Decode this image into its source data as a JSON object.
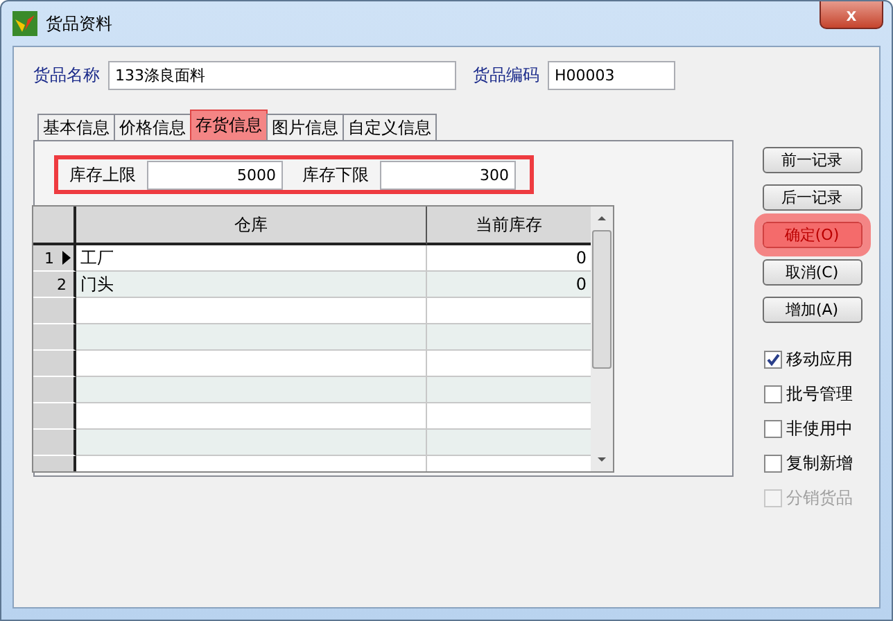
{
  "window": {
    "title": "货品资料",
    "close": "x"
  },
  "header_fields": [
    {
      "label": "货品名称",
      "value": "133涤良面料"
    },
    {
      "label": "货品编码",
      "value": "H00003"
    }
  ],
  "tabs": [
    {
      "label": "基本信息",
      "selected": false,
      "highlighted": false
    },
    {
      "label": "价格信息",
      "selected": false,
      "highlighted": false
    },
    {
      "label": "存货信息",
      "selected": true,
      "highlighted": true
    },
    {
      "label": "图片信息",
      "selected": false,
      "highlighted": false
    },
    {
      "label": "自定义信息",
      "selected": false,
      "highlighted": false
    }
  ],
  "stock_limits": {
    "highlighted": true,
    "fields": [
      {
        "label": "库存上限",
        "value": "5000"
      },
      {
        "label": "库存下限",
        "value": "300"
      }
    ]
  },
  "table": {
    "columns": [
      "仓库",
      "当前库存"
    ],
    "rows": [
      {
        "number": "1",
        "current": true,
        "cells": [
          "工厂",
          "0"
        ]
      },
      {
        "number": "2",
        "current": false,
        "cells": [
          "门头",
          "0"
        ]
      }
    ]
  },
  "buttons": [
    {
      "label": "前一记录",
      "highlighted": false
    },
    {
      "label": "后一记录",
      "highlighted": false
    },
    {
      "label": "确定(O)",
      "highlighted": true
    },
    {
      "label": "取消(C)",
      "highlighted": false
    },
    {
      "label": "增加(A)",
      "highlighted": false
    }
  ],
  "options": [
    {
      "label": "移动应用",
      "checked": true,
      "disabled": false
    },
    {
      "label": "批号管理",
      "checked": false,
      "disabled": false
    },
    {
      "label": "非使用中",
      "checked": false,
      "disabled": false
    },
    {
      "label": "复制新增",
      "checked": false,
      "disabled": false
    },
    {
      "label": "分销货品",
      "checked": false,
      "disabled": true
    }
  ]
}
